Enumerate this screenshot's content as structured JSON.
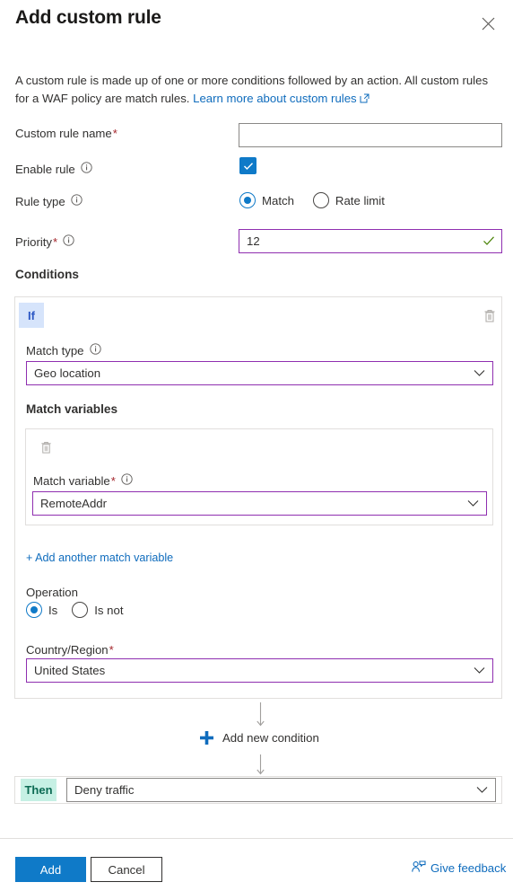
{
  "header": {
    "title": "Add custom rule",
    "close_icon": "close-icon"
  },
  "intro": {
    "text_before_link": "A custom rule is made up of one or more conditions followed by an action. All custom rules for a WAF policy are match rules. ",
    "link_text": "Learn more about custom rules",
    "link_icon": "external-link-icon"
  },
  "form": {
    "custom_rule_name": {
      "label": "Custom rule name",
      "required": "*",
      "value": "",
      "placeholder": ""
    },
    "enable_rule": {
      "label": "Enable rule",
      "info_icon": "info-icon",
      "checked": true,
      "check_icon": "checkmark-icon"
    },
    "rule_type": {
      "label": "Rule type",
      "info_icon": "info-icon",
      "selected": "Match",
      "options": [
        "Match",
        "Rate limit"
      ]
    },
    "priority": {
      "label": "Priority",
      "required": "*",
      "info_icon": "info-icon",
      "value": "12",
      "validation_icon": "valid-checkmark-icon"
    }
  },
  "conditions": {
    "heading": "Conditions",
    "condition": {
      "badge": "If",
      "delete_icon": "trash-icon",
      "match_type": {
        "label": "Match type",
        "info_icon": "info-icon",
        "value": "Geo location",
        "chevron_icon": "chevron-down-icon"
      },
      "match_variables": {
        "heading": "Match variables",
        "delete_icon": "trash-icon",
        "match_variable": {
          "label": "Match variable",
          "required": "*",
          "info_icon": "info-icon",
          "value": "RemoteAddr",
          "chevron_icon": "chevron-down-icon"
        },
        "add_link": "+ Add another match variable"
      },
      "operation": {
        "label": "Operation",
        "selected": "Is",
        "options": [
          "Is",
          "Is not"
        ]
      },
      "country_region": {
        "label": "Country/Region",
        "required": "*",
        "value": "United States",
        "chevron_icon": "chevron-down-icon"
      }
    },
    "add_new_condition": {
      "label": "Add new condition",
      "plus_icon": "plus-icon",
      "arrow_icon": "arrow-down-icon"
    }
  },
  "action": {
    "badge": "Then",
    "value": "Deny traffic",
    "chevron_icon": "chevron-down-icon"
  },
  "footer": {
    "add_label": "Add",
    "cancel_label": "Cancel",
    "feedback_label": "Give feedback",
    "feedback_icon": "feedback-person-icon"
  },
  "colors": {
    "accent_blue": "#0f7ac8",
    "link_blue": "#0f6cbd",
    "required_red": "#a4262c",
    "field_purple": "#8f2fb0",
    "valid_green": "#498205",
    "badge_if_bg": "#d6e4fb",
    "badge_then_bg": "#c6f0e4"
  }
}
